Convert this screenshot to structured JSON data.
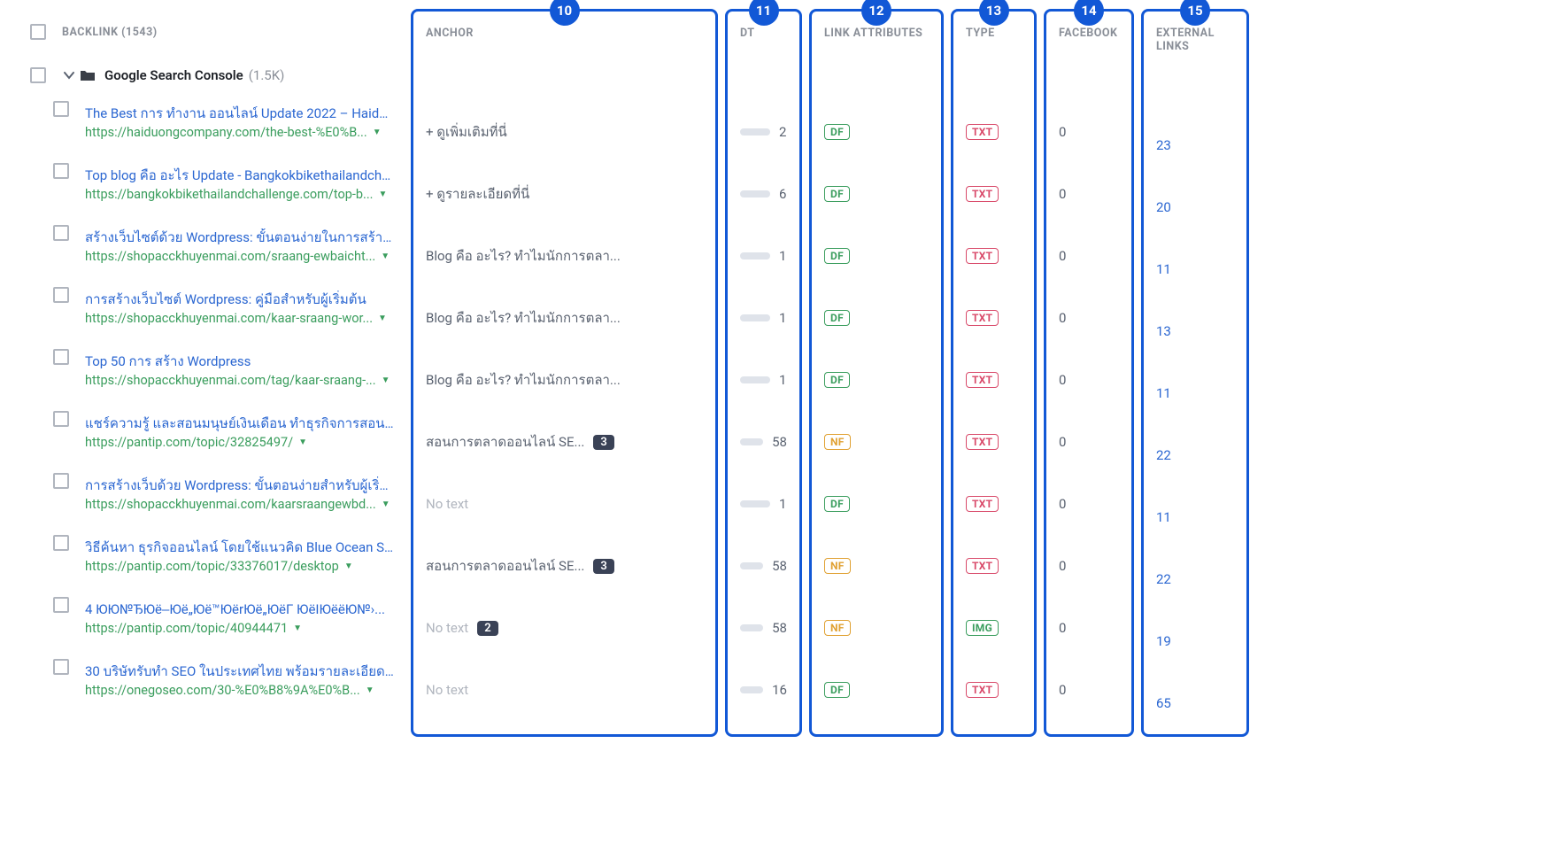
{
  "header": {
    "backlink_label": "BACKLINK (1543)",
    "columns": {
      "anchor": "ANCHOR",
      "dt": "DT",
      "link_attributes": "LINK ATTRIBUTES",
      "type": "TYPE",
      "facebook": "FACEBOOK",
      "external_links": "EXTERNAL LINKS"
    },
    "badges": {
      "anchor": "10",
      "dt": "11",
      "link_attributes": "12",
      "type": "13",
      "facebook": "14",
      "external_links": "15"
    }
  },
  "group": {
    "name": "Google Search Console",
    "count": "(1.5K)"
  },
  "rows": [
    {
      "title": "The Best การ ทํางาน ออนไลน์ Update 2022 – Haiduon...",
      "url": "https://haiduongcompany.com/the-best-%E0%B...",
      "anchor": "+ ดูเพิ่มเติมที่นี่",
      "dt": "2",
      "dt_pct": 6,
      "attr": "DF",
      "type": "TXT",
      "fb": "0",
      "ext": "23"
    },
    {
      "title": "Top blog คือ อะไร Update - Bangkokbikethailandchall...",
      "url": "https://bangkokbikethailandchallenge.com/top-b...",
      "anchor": "+ ดูรายละเอียดที่นี่",
      "dt": "6",
      "dt_pct": 12,
      "attr": "DF",
      "type": "TXT",
      "fb": "0",
      "ext": "20"
    },
    {
      "title": "สร้างเว็บไซต์ด้วย Wordpress: ขั้นตอนง่ายในการสร้างเว็บ...",
      "url": "https://shopacckhuyenmai.com/sraang-ewbaicht...",
      "anchor": "Blog คือ อะไร? ทำไมนักการตลา...",
      "dt": "1",
      "dt_pct": 4,
      "attr": "DF",
      "type": "TXT",
      "fb": "0",
      "ext": "11"
    },
    {
      "title": "การสร้างเว็บไซต์ Wordpress: คู่มือสำหรับผู้เริ่มต้น",
      "url": "https://shopacckhuyenmai.com/kaar-sraang-wor...",
      "anchor": "Blog คือ อะไร? ทำไมนักการตลา...",
      "dt": "1",
      "dt_pct": 4,
      "attr": "DF",
      "type": "TXT",
      "fb": "0",
      "ext": "13"
    },
    {
      "title": "Top 50 การ สร้าง Wordpress",
      "url": "https://shopacckhuyenmai.com/tag/kaar-sraang-...",
      "anchor": "Blog คือ อะไร? ทำไมนักการตลา...",
      "dt": "1",
      "dt_pct": 4,
      "attr": "DF",
      "type": "TXT",
      "fb": "0",
      "ext": "11"
    },
    {
      "title": "แชร์ความรู้ และสอนมนุษย์เงินเดือน ทำธุรกิจการสอน สร้างร...",
      "url": "https://pantip.com/topic/32825497/",
      "anchor": "สอนการตลาดออนไลน์ SE...",
      "anchor_badge": "3",
      "dt": "58",
      "dt_pct": 60,
      "attr": "NF",
      "type": "TXT",
      "fb": "0",
      "ext": "22"
    },
    {
      "title": "การสร้างเว็บด้วย Wordpress: ขั้นตอนง่ายสำหรับผู้เริ่มต้น",
      "url": "https://shopacckhuyenmai.com/kaarsraangewbd...",
      "anchor": "No text",
      "no_text": true,
      "dt": "1",
      "dt_pct": 4,
      "attr": "DF",
      "type": "TXT",
      "fb": "0",
      "ext": "11"
    },
    {
      "title": "วิธีค้นหา ธุรกิจออนไลน์ โดยใช้แนวคิด Blue Ocean Strate...",
      "url": "https://pantip.com/topic/33376017/desktop",
      "anchor": "สอนการตลาดออนไลน์ SE...",
      "anchor_badge": "3",
      "dt": "58",
      "dt_pct": 60,
      "attr": "NF",
      "type": "TXT",
      "fb": "0",
      "ext": "22"
    },
    {
      "title": "4 ЮЮ№ЂЮё‒Юё„Юё™ЮёrЮё„ЮёГ ЮёIЮёёЮ№›...",
      "url": "https://pantip.com/topic/40944471",
      "anchor": "No text",
      "no_text": true,
      "anchor_badge": "2",
      "dt": "58",
      "dt_pct": 60,
      "attr": "NF",
      "type": "IMG",
      "fb": "0",
      "ext": "19"
    },
    {
      "title": "30 บริษัทรับทำ SEO ในประเทศไทย พร้อมรายละเอียด อัพ...",
      "url": "https://onegoseo.com/30-%E0%B8%9A%E0%B...",
      "anchor": "No text",
      "no_text": true,
      "dt": "16",
      "dt_pct": 20,
      "attr": "DF",
      "type": "TXT",
      "fb": "0",
      "ext": "65"
    }
  ]
}
